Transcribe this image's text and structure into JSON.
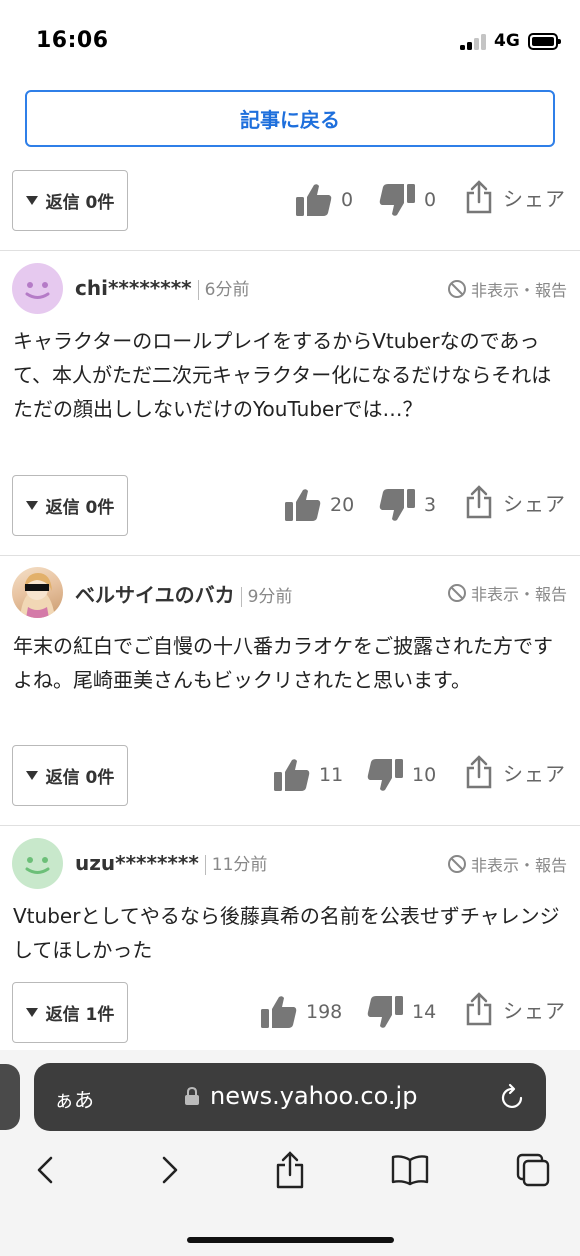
{
  "status_bar": {
    "time": "16:06",
    "network": "4G"
  },
  "back_button_label": "記事に戻る",
  "first_action_row": {
    "reply_label": "返信 0件",
    "likes": "0",
    "dislikes": "0",
    "share_label": "シェア"
  },
  "comments": [
    {
      "user": "chi********",
      "time": "6分前",
      "hide_report": "非表示・報告",
      "text": "キャラクターのロールプレイをするからVtuberなのであって、本人がただ二次元キャラクター化になるだけならそれはただの顔出ししないだけのYouTuberでは…？",
      "reply_label": "返信 0件",
      "likes": "20",
      "dislikes": "3",
      "share_label": "シェア",
      "avatar_color": "#e6c9ef"
    },
    {
      "user": "ベルサイユのバカ",
      "time": "9分前",
      "hide_report": "非表示・報告",
      "text": "年末の紅白でご自慢の十八番カラオケをご披露された方ですよね。尾崎亜美さんもビックリされたと思います。",
      "reply_label": "返信 0件",
      "likes": "11",
      "dislikes": "10",
      "share_label": "シェア"
    },
    {
      "user": "uzu********",
      "time": "11分前",
      "hide_report": "非表示・報告",
      "text": "Vtuberとしてやるなら後藤真希の名前を公表せずチャレンジしてほしかった",
      "reply_label": "返信 1件",
      "likes": "198",
      "dislikes": "14",
      "share_label": "シェア",
      "avatar_color": "#c8e8cb"
    }
  ],
  "browser": {
    "aa_label": "ぁあ",
    "url": "news.yahoo.co.jp"
  },
  "colors": {
    "accent": "#2f7fe8",
    "icon_gray": "#777777"
  }
}
